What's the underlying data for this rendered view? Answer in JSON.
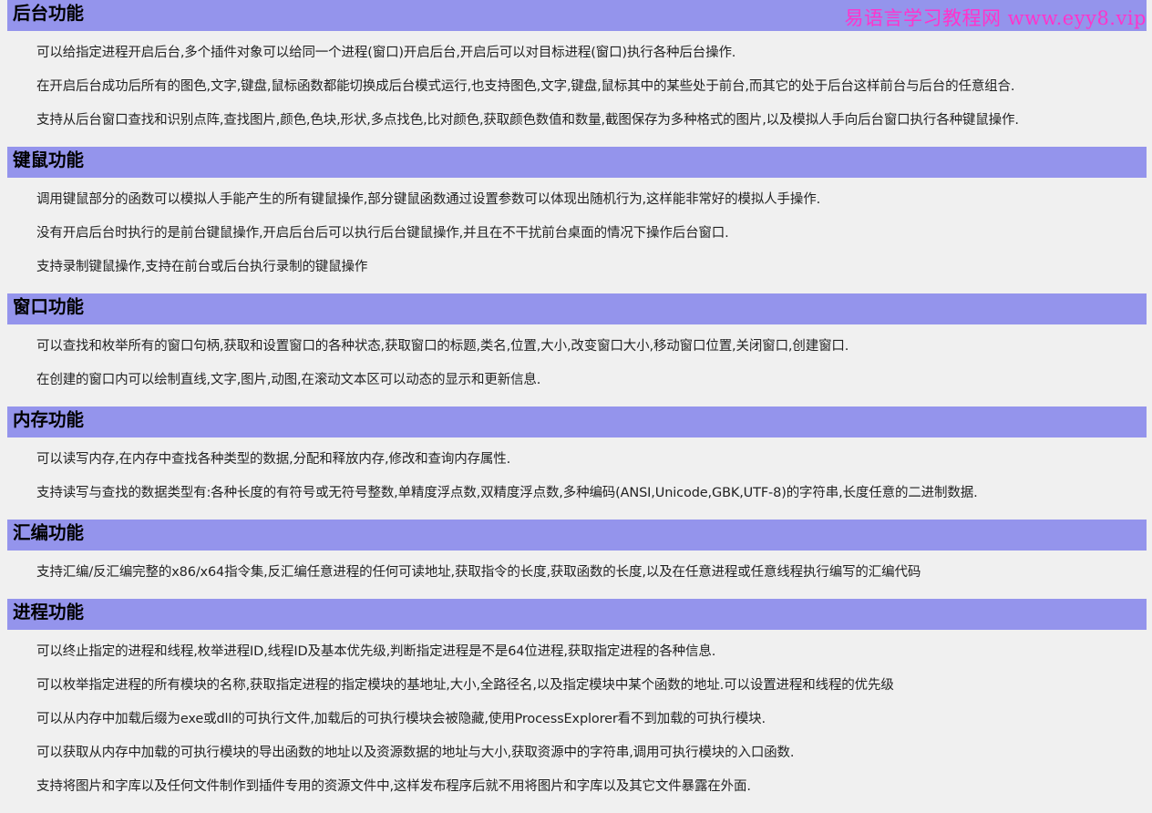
{
  "watermark": "易语言学习教程网 www.eyy8.vip",
  "sections": [
    {
      "title": "后台功能",
      "paragraphs": [
        "可以给指定进程开启后台,多个插件对象可以给同一个进程(窗口)开启后台,开启后可以对目标进程(窗口)执行各种后台操作.",
        "在开启后台成功后所有的图色,文字,键盘,鼠标函数都能切换成后台模式运行,也支持图色,文字,键盘,鼠标其中的某些处于前台,而其它的处于后台这样前台与后台的任意组合.",
        "支持从后台窗口查找和识别点阵,查找图片,颜色,色块,形状,多点找色,比对颜色,获取颜色数值和数量,截图保存为多种格式的图片,以及模拟人手向后台窗口执行各种键鼠操作."
      ]
    },
    {
      "title": "键鼠功能",
      "paragraphs": [
        "调用键鼠部分的函数可以模拟人手能产生的所有键鼠操作,部分键鼠函数通过设置参数可以体现出随机行为,这样能非常好的模拟人手操作.",
        "没有开启后台时执行的是前台键鼠操作,开启后台后可以执行后台键鼠操作,并且在不干扰前台桌面的情况下操作后台窗口.",
        "支持录制键鼠操作,支持在前台或后台执行录制的键鼠操作"
      ]
    },
    {
      "title": "窗口功能",
      "paragraphs": [
        "可以查找和枚举所有的窗口句柄,获取和设置窗口的各种状态,获取窗口的标题,类名,位置,大小,改变窗口大小,移动窗口位置,关闭窗口,创建窗口.",
        "在创建的窗口内可以绘制直线,文字,图片,动图,在滚动文本区可以动态的显示和更新信息."
      ]
    },
    {
      "title": "内存功能",
      "paragraphs": [
        "可以读写内存,在内存中查找各种类型的数据,分配和释放内存,修改和查询内存属性.",
        "支持读写与查找的数据类型有:各种长度的有符号或无符号整数,单精度浮点数,双精度浮点数,多种编码(ANSI,Unicode,GBK,UTF-8)的字符串,长度任意的二进制数据."
      ]
    },
    {
      "title": "汇编功能",
      "paragraphs": [
        "支持汇编/反汇编完整的x86/x64指令集,反汇编任意进程的任何可读地址,获取指令的长度,获取函数的长度,以及在任意进程或任意线程执行编写的汇编代码"
      ]
    },
    {
      "title": "进程功能",
      "paragraphs": [
        "可以终止指定的进程和线程,枚举进程ID,线程ID及基本优先级,判断指定进程是不是64位进程,获取指定进程的各种信息.",
        "可以枚举指定进程的所有模块的名称,获取指定进程的指定模块的基地址,大小,全路径名,以及指定模块中某个函数的地址.可以设置进程和线程的优先级",
        "可以从内存中加载后缀为exe或dll的可执行文件,加载后的可执行模块会被隐藏,使用ProcessExplorer看不到加载的可执行模块.",
        "可以获取从内存中加载的可执行模块的导出函数的地址以及资源数据的地址与大小,获取资源中的字符串,调用可执行模块的入口函数.",
        "支持将图片和字库以及任何文件制作到插件专用的资源文件中,这样发布程序后就不用将图片和字库以及其它文件暴露在外面."
      ]
    }
  ]
}
